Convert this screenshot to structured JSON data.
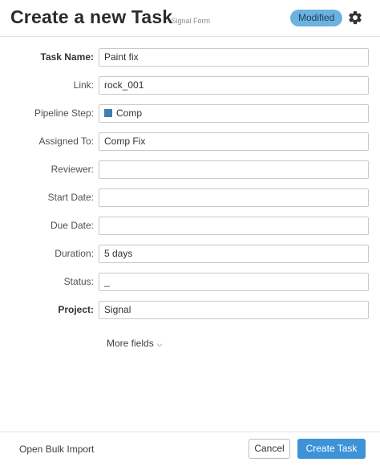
{
  "header": {
    "title": "Create a new Task",
    "subtitle": "- Signal Form",
    "badge": "Modified",
    "settings_icon": "gear-icon"
  },
  "fields": [
    {
      "key": "task_name",
      "label": "Task Name:",
      "value": "Paint fix",
      "bold": true
    },
    {
      "key": "link",
      "label": "Link:",
      "value": "rock_001",
      "bold": false
    },
    {
      "key": "pipeline_step",
      "label": "Pipeline Step:",
      "value": "Comp",
      "bold": false,
      "swatch_color": "#3f7fb7"
    },
    {
      "key": "assigned_to",
      "label": "Assigned To:",
      "value": "Comp Fix",
      "bold": false
    },
    {
      "key": "reviewer",
      "label": "Reviewer:",
      "value": "",
      "bold": false
    },
    {
      "key": "start_date",
      "label": "Start Date:",
      "value": "",
      "bold": false
    },
    {
      "key": "due_date",
      "label": "Due Date:",
      "value": "",
      "bold": false
    },
    {
      "key": "duration",
      "label": "Duration:",
      "value": "5 days",
      "bold": false
    },
    {
      "key": "status",
      "label": "Status:",
      "value": "_",
      "bold": false
    },
    {
      "key": "project",
      "label": "Project:",
      "value": "Signal",
      "bold": true
    }
  ],
  "more_fields": {
    "label": "More fields",
    "icon": "chevron-down-icon"
  },
  "footer": {
    "bulk_import": "Open Bulk Import",
    "cancel": "Cancel",
    "create": "Create Task"
  },
  "colors": {
    "accent": "#3d92d8",
    "badge": "#6bb2e0"
  }
}
